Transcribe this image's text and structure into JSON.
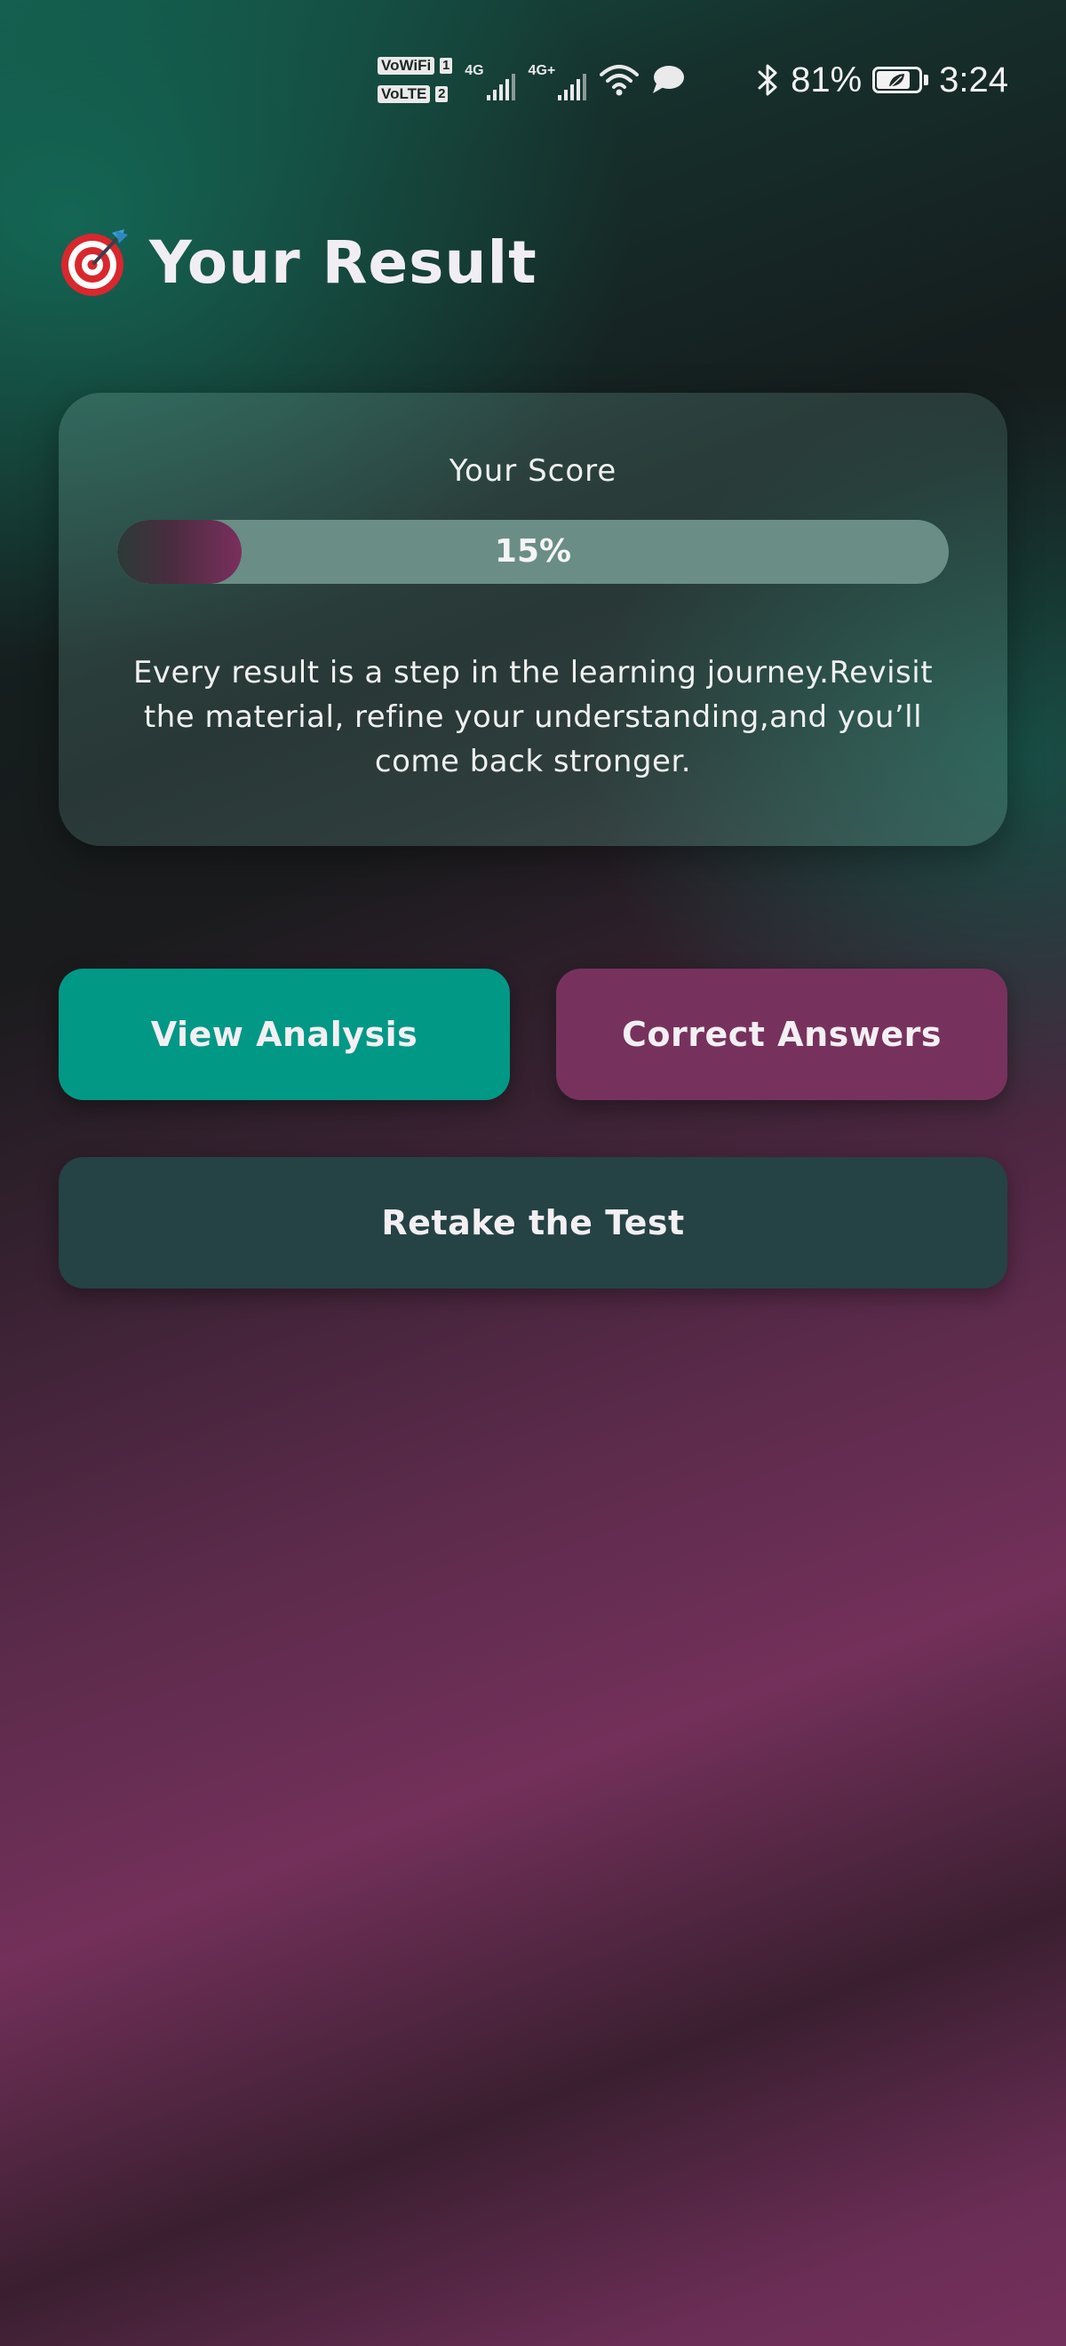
{
  "status_bar": {
    "sim1_label": "VoWiFi",
    "sim1_num": "1",
    "sim2_label": "VoLTE",
    "sim2_num": "2",
    "net1_label": "4G",
    "net2_label": "4G+",
    "battery_percent_text": "81%",
    "battery_level": 0.81,
    "time": "3:24",
    "icons": [
      "signal-bars-icon",
      "wifi-icon",
      "message-bubble-icon",
      "bluetooth-icon",
      "battery-saver-leaf-icon"
    ]
  },
  "header": {
    "icon": "target-dart-icon",
    "title": "Your Result"
  },
  "score_card": {
    "label": "Your Score",
    "progress_text": "15%",
    "progress_value": 0.15,
    "message": "Every result is a step in the learning journey.Revisit the material, refine your understanding,and you’ll come back stronger."
  },
  "buttons": {
    "view_analysis": "View Analysis",
    "correct_answers": "Correct Answers",
    "retake": "Retake the Test"
  },
  "colors": {
    "teal_button": "#029886",
    "plum_button": "#76325d",
    "retake_button": "#254244",
    "progress_track": "#6a8d85",
    "progress_fill": "#7a2f5d"
  }
}
